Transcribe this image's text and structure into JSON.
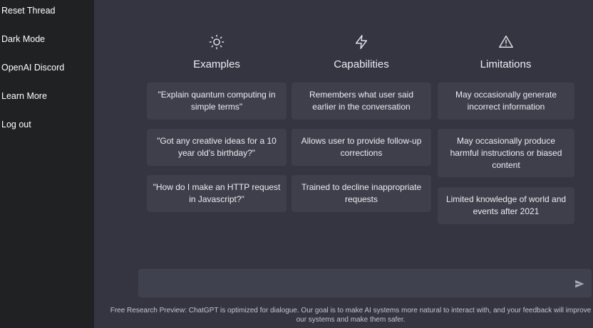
{
  "sidebar": {
    "items": [
      {
        "label": "Reset Thread"
      },
      {
        "label": "Dark Mode"
      },
      {
        "label": "OpenAI Discord"
      },
      {
        "label": "Learn More"
      },
      {
        "label": "Log out"
      }
    ]
  },
  "columns": [
    {
      "icon": "sun-icon",
      "title": "Examples",
      "cards": [
        "\"Explain quantum computing in simple terms\"",
        "\"Got any creative ideas for a 10 year old’s birthday?\"",
        "\"How do I make an HTTP request in Javascript?\""
      ]
    },
    {
      "icon": "lightning-icon",
      "title": "Capabilities",
      "cards": [
        "Remembers what user said earlier in the conversation",
        "Allows user to provide follow-up corrections",
        "Trained to decline inappropriate requests"
      ]
    },
    {
      "icon": "warning-icon",
      "title": "Limitations",
      "cards": [
        "May occasionally generate incorrect information",
        "May occasionally produce harmful instructions or biased content",
        "Limited knowledge of world and events after 2021"
      ]
    }
  ],
  "input": {
    "placeholder": "",
    "send_icon": "send-icon"
  },
  "footer": {
    "text": "Free Research Preview: ChatGPT is optimized for dialogue. Our goal is to make AI systems more natural to interact with, and your feedback will improve our systems and make them safer."
  }
}
